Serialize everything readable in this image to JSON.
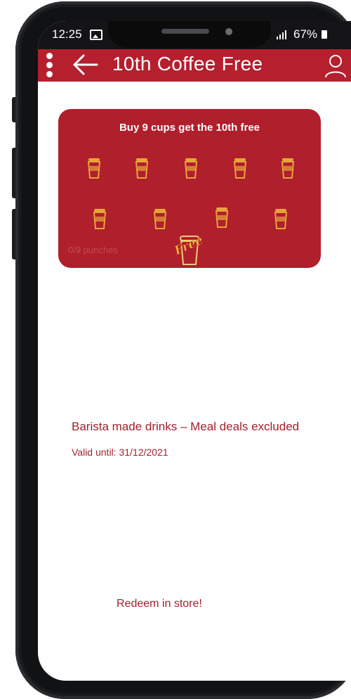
{
  "status_bar": {
    "time": "12:25",
    "signal": "↲.││",
    "battery": "67%"
  },
  "app_bar": {
    "title": "10th Coffee Free",
    "menu_icon": "more-vertical-icon",
    "back_icon": "arrow-left-icon",
    "profile_icon": "user-icon"
  },
  "card": {
    "title": "Buy 9 cups get the 10th free",
    "punches_label": "0/9 punches",
    "punched": 0,
    "total": 9,
    "free_badge": "Free",
    "cup_icon": "coffee-cup-icon"
  },
  "details": {
    "terms": "Barista made drinks – Meal deals excluded",
    "valid_until": "Valid until: 31/12/2021"
  },
  "footer": {
    "redeem_text": "Redeem in store!"
  },
  "colors": {
    "brand_red": "#b51f2e",
    "card_red": "#b01f2c",
    "cup_gold": "#e8a43a",
    "text_red": "#a21f2c"
  }
}
